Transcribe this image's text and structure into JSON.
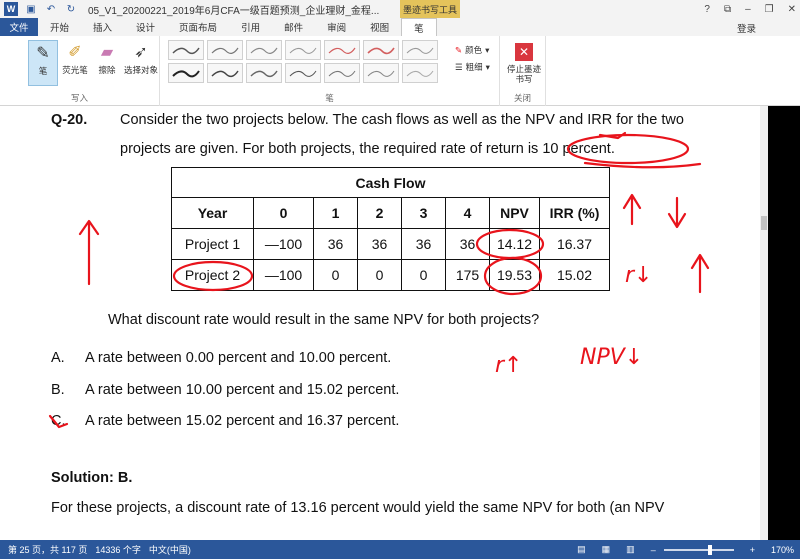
{
  "titlebar": {
    "app_icon": "W",
    "doc_title": "05_V1_20200221_2019年6月CFA一级百题预测_企业理财_金程...",
    "context_tab": "墨迹书写工具"
  },
  "tabs": {
    "file": "文件",
    "items": [
      "开始",
      "插入",
      "设计",
      "页面布局",
      "引用",
      "邮件",
      "审阅",
      "视图",
      "笔"
    ],
    "login": "登录"
  },
  "ribbon": {
    "write_group": {
      "buttons": [
        "笔",
        "荧光笔",
        "擦除",
        "选择对象"
      ],
      "label": "写入"
    },
    "pens_group": {
      "label": "笔",
      "color": "颜色",
      "thickness": "粗细"
    },
    "close_group": {
      "button": "停止墨迹书写",
      "label": "关闭"
    }
  },
  "document": {
    "question_number": "Q-20.",
    "question_line1": "Consider the two projects below. The cash flows as well as the NPV and IRR for the two",
    "question_line2": "projects are given. For both projects, the required rate of return is 10 percent.",
    "table": {
      "caption": "Cash Flow",
      "headers": [
        "Year",
        "0",
        "1",
        "2",
        "3",
        "4",
        "NPV",
        "IRR (%)"
      ],
      "rows": [
        [
          "Project 1",
          "—100",
          "36",
          "36",
          "36",
          "36",
          "14.12",
          "16.37"
        ],
        [
          "Project 2",
          "—100",
          "0",
          "0",
          "0",
          "175",
          "19.53",
          "15.02"
        ]
      ]
    },
    "prompt": "What discount rate would result in the same NPV for both projects?",
    "options": [
      {
        "letter": "A.",
        "text": "A rate between 0.00 percent and 10.00 percent."
      },
      {
        "letter": "B.",
        "text": "A rate between 10.00 percent and 15.02 percent."
      },
      {
        "letter": "C.",
        "text": "A rate between 15.02 percent and 16.37 percent."
      }
    ],
    "solution_title": "Solution: B.",
    "solution_line": "For these projects, a discount rate of 13.16 percent would yield the same NPV for both (an NPV",
    "ink_notes": [
      "r↓",
      "r↑",
      "NPV↓"
    ]
  },
  "statusbar": {
    "page": "第 25 页，共 117 页",
    "words": "14336 个字",
    "lang": "中文(中国)",
    "zoom": "170%"
  },
  "colors": {
    "accent": "#2b579a",
    "ink": "#e8141c",
    "context_tab": "#e4c35b"
  }
}
